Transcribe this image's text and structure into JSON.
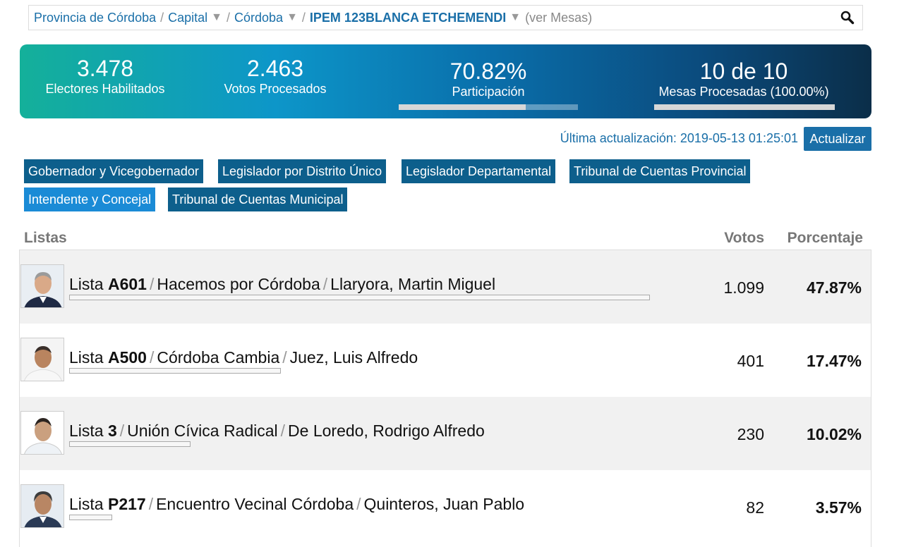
{
  "breadcrumb": {
    "items": [
      "Provincia de Córdoba",
      "Capital",
      "Córdoba",
      "IPEM 123BLANCA ETCHEMENDI"
    ],
    "separator": "/",
    "dropdown_glyph": "▼",
    "ver_mesas": "(ver Mesas)",
    "search_icon": "search-icon"
  },
  "stats": {
    "electores_value": "3.478",
    "electores_label": "Electores Habilitados",
    "votos_value": "2.463",
    "votos_label": "Votos Procesados",
    "participacion_value": "70.82%",
    "participacion_label": "Participación",
    "participacion_fraction": 0.7082,
    "mesas_value": "10 de 10",
    "mesas_label": "Mesas Procesadas (100.00%)",
    "mesas_fraction": 1.0
  },
  "update": {
    "text": "Última actualización: 2019-05-13 01:25:01",
    "button_label": "Actualizar"
  },
  "tabs": [
    {
      "label": "Gobernador y Vicegobernador",
      "active": false
    },
    {
      "label": "Legislador por Distrito Único",
      "active": false
    },
    {
      "label": "Legislador Departamental",
      "active": false
    },
    {
      "label": "Tribunal de Cuentas Provincial",
      "active": false
    },
    {
      "label": "Intendente y Concejal",
      "active": true
    },
    {
      "label": "Tribunal de Cuentas Municipal",
      "active": false
    }
  ],
  "table": {
    "headers": {
      "listas": "Listas",
      "votos": "Votos",
      "porcentaje": "Porcentaje"
    },
    "rows": [
      {
        "prefix": "Lista",
        "code": "A601",
        "party": "Hacemos por Córdoba",
        "candidate": "Llaryora, Martin Miguel",
        "votes": "1.099",
        "percent": "47.87%",
        "share": 0.4787
      },
      {
        "prefix": "Lista",
        "code": "A500",
        "party": "Córdoba Cambia",
        "candidate": "Juez, Luis Alfredo",
        "votes": "401",
        "percent": "17.47%",
        "share": 0.1747
      },
      {
        "prefix": "Lista",
        "code": "3",
        "party": "Unión Cívica Radical",
        "candidate": "De Loredo, Rodrigo Alfredo",
        "votes": "230",
        "percent": "10.02%",
        "share": 0.1002
      },
      {
        "prefix": "Lista",
        "code": "P217",
        "party": "Encuentro Vecinal Córdoba",
        "candidate": "Quinteros, Juan Pablo",
        "votes": "82",
        "percent": "3.57%",
        "share": 0.0357
      }
    ]
  },
  "colors": {
    "link_blue": "#1a6fa8",
    "tab_dark": "#0d5f8c",
    "tab_active": "#1a8bd6",
    "banner_start": "#14b09a",
    "banner_end": "#0b2e49"
  }
}
